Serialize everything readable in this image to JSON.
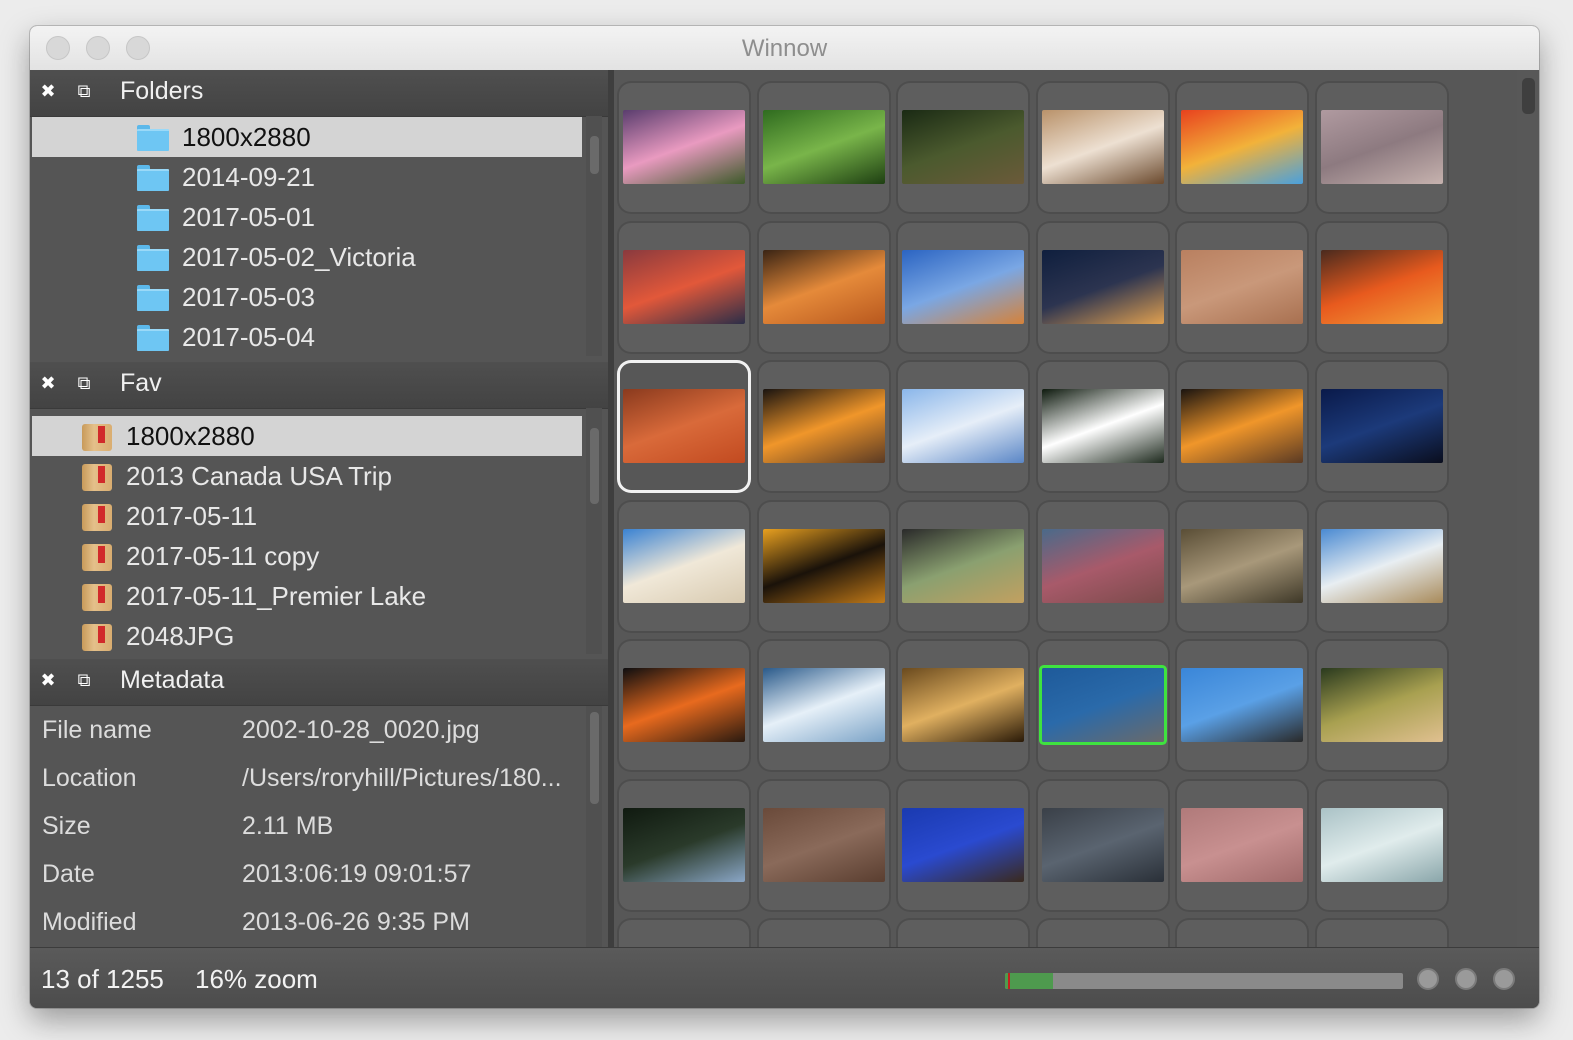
{
  "window": {
    "title": "Winnow"
  },
  "folders": {
    "title": "Folders",
    "items": [
      "1800x2880",
      "2014-09-21",
      "2017-05-01",
      "2017-05-02_Victoria",
      "2017-05-03",
      "2017-05-04"
    ],
    "selected_index": 0
  },
  "fav": {
    "title": "Fav",
    "items": [
      "1800x2880",
      "2013 Canada USA Trip",
      "2017-05-11",
      "2017-05-11 copy",
      "2017-05-11_Premier Lake",
      "2048JPG"
    ],
    "selected_index": 0
  },
  "metadata": {
    "title": "Metadata",
    "rows": [
      {
        "key": "File name",
        "value": "2002-10-28_0020.jpg"
      },
      {
        "key": "Location",
        "value": "/Users/roryhill/Pictures/180..."
      },
      {
        "key": "Size",
        "value": "2.11 MB"
      },
      {
        "key": "Date",
        "value": "2013:06:19 09:01:57"
      },
      {
        "key": "Modified",
        "value": "2013-06-26 9:35 PM"
      }
    ]
  },
  "status": {
    "count": "13 of 1255",
    "zoom": "16% zoom",
    "progress_fraction": 0.12
  },
  "grid": {
    "current_index": 12,
    "picked_index": 27,
    "thumbs": [
      [
        "#5a3d6e",
        "#e99ac0",
        "#3d5a2a"
      ],
      [
        "#2f6b1f",
        "#79b54a",
        "#1e3f12"
      ],
      [
        "#1a2a14",
        "#4b5a2e",
        "#6b5a3a"
      ],
      [
        "#b9926a",
        "#ede0d2",
        "#6b4a2e"
      ],
      [
        "#e8421e",
        "#f2b23a",
        "#4aa0dd"
      ],
      [
        "#b09aa0",
        "#8d7a80",
        "#c6b2ae"
      ],
      [
        "#8a3a3e",
        "#e2583a",
        "#2b2e48"
      ],
      [
        "#3a2414",
        "#e58a3a",
        "#b8581e"
      ],
      [
        "#2b64c2",
        "#7aa7e4",
        "#d5823a"
      ],
      [
        "#0f1f3e",
        "#2c3450",
        "#e0a050"
      ],
      [
        "#b98060",
        "#c9987a",
        "#a87050"
      ],
      [
        "#4a2a1e",
        "#e85a1e",
        "#f2a03a"
      ],
      [
        "#8a3a1e",
        "#d96a3a",
        "#c24a20"
      ],
      [
        "#1a1410",
        "#f0962a",
        "#5a3a24"
      ],
      [
        "#8ab6ea",
        "#e6eef8",
        "#5a86c6"
      ],
      [
        "#0e1a0e",
        "#ffffff",
        "#1e2a1e"
      ],
      [
        "#1a1410",
        "#f0962a",
        "#5a3a24"
      ],
      [
        "#0a1a4a",
        "#1c3a7a",
        "#0a0e1e"
      ],
      [
        "#3a82d2",
        "#f0e8d8",
        "#d8cab0"
      ],
      [
        "#e8a020",
        "#1a120a",
        "#c27a18"
      ],
      [
        "#2a2a2a",
        "#8aa070",
        "#c2a060"
      ],
      [
        "#4a6a8a",
        "#a85a6a",
        "#7a4a4a"
      ],
      [
        "#5a4e36",
        "#a8987a",
        "#3e3828"
      ],
      [
        "#4a8ad2",
        "#e8eef2",
        "#a88a5a"
      ],
      [
        "#0e0e10",
        "#e86a1e",
        "#2a1a10"
      ],
      [
        "#2a5a8a",
        "#e6f0f8",
        "#7aa2c6"
      ],
      [
        "#6a4a1e",
        "#e0b060",
        "#2a1a08"
      ],
      [
        "#1e5a9a",
        "#2a6aaa",
        "#6a6a6a"
      ],
      [
        "#3a86d8",
        "#5aa0e6",
        "#2a2a2a"
      ],
      [
        "#2a3a1e",
        "#a8a050",
        "#e0c090"
      ],
      [
        "#101a10",
        "#2a3a2a",
        "#8aa6c6"
      ],
      [
        "#6a4a3a",
        "#8a6a5a",
        "#5a3e30"
      ],
      [
        "#1a3ab0",
        "#2a4ad0",
        "#3a2a1e"
      ],
      [
        "#3a4048",
        "#5a6470",
        "#2a3038"
      ],
      [
        "#b07a7a",
        "#c89090",
        "#a06a6a"
      ],
      [
        "#aac2c6",
        "#e0ecec",
        "#8aa6aa"
      ],
      [
        "#2a4a1e",
        "#1e3a14",
        "#3a5a2a"
      ],
      [
        "#2a2a2a",
        "#3a3a3a",
        "#1e1e1e"
      ],
      [
        "#c0c0c0",
        "#8a8a8a",
        "#d0d0d0"
      ],
      [
        "#d2c030",
        "#a8a028",
        "#e0d040"
      ],
      [
        "#9a9a9a",
        "#6a6a6a",
        "#c2c2c2"
      ],
      [
        "#1e5ab0",
        "#2a6ad0",
        "#3a7ae0"
      ]
    ]
  }
}
